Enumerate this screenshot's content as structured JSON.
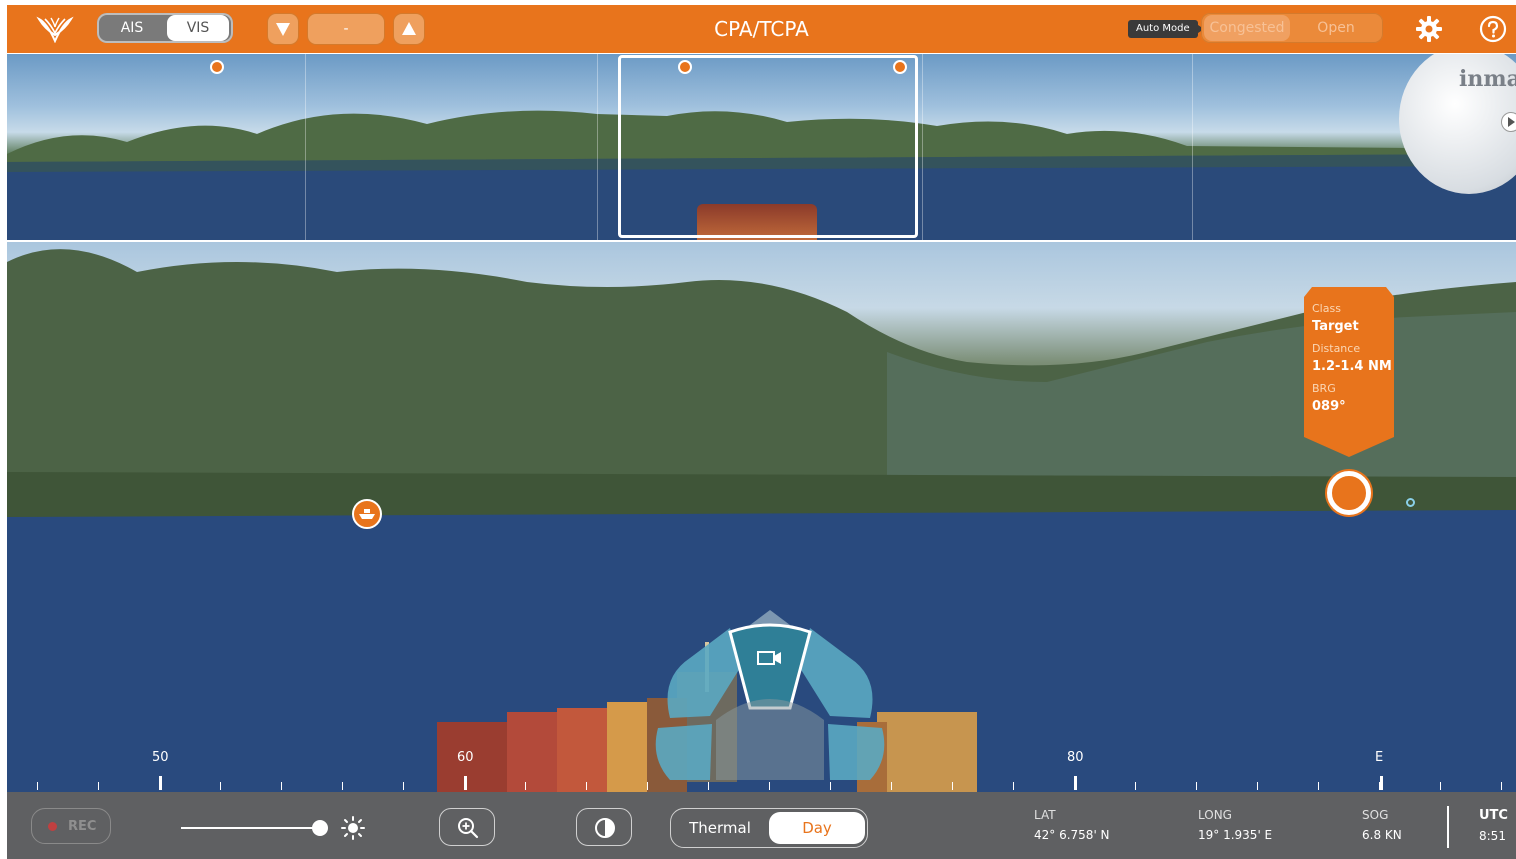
{
  "header": {
    "title": "CPA/TCPA",
    "source_toggle": {
      "ais_label": "AIS",
      "vis_label": "VIS",
      "selected": "VIS"
    },
    "range_value": "-",
    "auto_mode_label": "Auto Mode",
    "mode_toggle": {
      "congested_label": "Congested",
      "open_label": "Open",
      "selected": "Congested"
    }
  },
  "panorama": {
    "dome_text": "inma"
  },
  "target_tag": {
    "class_label": "Class",
    "class_value": "Target",
    "distance_label": "Distance",
    "distance_value": "1.2-1.4 NM",
    "brg_label": "BRG",
    "brg_value": "089°"
  },
  "compass": {
    "labels": [
      "50",
      "60",
      "80",
      "E"
    ]
  },
  "bottom": {
    "rec_label": "REC",
    "brightness": 0.95,
    "thermal_label": "Thermal",
    "day_label": "Day",
    "selected_mode": "Day",
    "lat_label": "LAT",
    "lat_value": "42° 6.758' N",
    "long_label": "LONG",
    "long_value": "19° 1.935' E",
    "sog_label": "SOG",
    "sog_value": "6.8 KN",
    "utc_label": "UTC",
    "utc_value": "8:51"
  },
  "colors": {
    "brand_orange": "#E8741C",
    "bottom_bar": "#5f6062",
    "dial_teal": "#5aa9c2"
  },
  "icons": [
    "logo-icon",
    "triangle-down-icon",
    "triangle-up-icon",
    "gear-icon",
    "help-icon",
    "ship-icon",
    "camera-icon",
    "sun-icon",
    "zoom-in-icon",
    "contrast-icon",
    "play-icon"
  ]
}
